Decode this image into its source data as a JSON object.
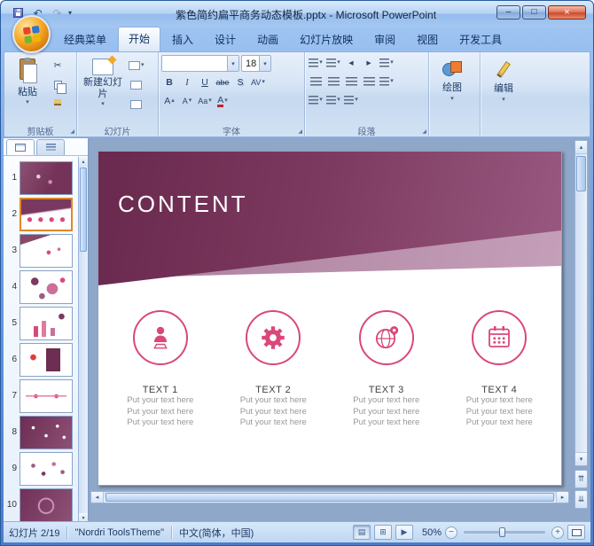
{
  "window": {
    "title": "紫色简约扁平商务动态模板.pptx - Microsoft PowerPoint",
    "minimize": "–",
    "maximize": "□",
    "close": "×"
  },
  "icons": {
    "undo": "↶",
    "redo": "↷",
    "caret": "▾",
    "caret_up": "▴",
    "cut": "✂",
    "arrow_up": "▴",
    "arrow_down": "▾",
    "arrow_left": "◂",
    "arrow_right": "▸",
    "prev_slides": "⇈",
    "next_slides": "⇊",
    "view_normal": "▤",
    "view_sorter": "⊞",
    "view_show": "▶",
    "zoom_out": "−",
    "zoom_in": "+",
    "launcher": "◢"
  },
  "ribbon": {
    "tabs": [
      "经典菜单",
      "开始",
      "插入",
      "设计",
      "动画",
      "幻灯片放映",
      "审阅",
      "视图",
      "开发工具"
    ],
    "active_tab": "开始",
    "clipboard": {
      "group_label": "剪贴板",
      "paste": "粘贴"
    },
    "slides_group": {
      "group_label": "幻灯片",
      "new_slide": "新建幻灯片"
    },
    "font": {
      "group_label": "字体",
      "font_name": "",
      "font_size": "18",
      "bold": "B",
      "italic": "I",
      "underline": "U",
      "strikethrough": "abe",
      "shadow": "S",
      "char_spacing": "AV",
      "change_case": "Aa",
      "color_letter": "A",
      "grow_letter": "A",
      "shrink_letter": "A"
    },
    "paragraph": {
      "group_label": "段落"
    },
    "drawing": {
      "label": "绘图"
    },
    "editing": {
      "label": "编辑"
    }
  },
  "panel": {
    "slides": [
      {
        "number": "1"
      },
      {
        "number": "2"
      },
      {
        "number": "3"
      },
      {
        "number": "4"
      },
      {
        "number": "5"
      },
      {
        "number": "6"
      },
      {
        "number": "7"
      },
      {
        "number": "8"
      },
      {
        "number": "9"
      },
      {
        "number": "10"
      }
    ],
    "selected_number": "2"
  },
  "slide": {
    "title": "CONTENT",
    "items": [
      {
        "heading": "TEXT 1",
        "lines": [
          "Put your text here",
          "Put your text here",
          "Put your text here"
        ]
      },
      {
        "heading": "TEXT 2",
        "lines": [
          "Put your text here",
          "Put your text here",
          "Put your text here"
        ]
      },
      {
        "heading": "TEXT 3",
        "lines": [
          "Put your text here",
          "Put your text here",
          "Put your text here"
        ]
      },
      {
        "heading": "TEXT 4",
        "lines": [
          "Put your text here",
          "Put your text here",
          "Put your text here"
        ]
      }
    ]
  },
  "statusbar": {
    "slide_indicator": "幻灯片 2/19",
    "theme": "\"Nordri ToolsTheme\"",
    "language": "中文(简体，中国)",
    "zoom": "50%"
  },
  "colors": {
    "accent_pink": "#d9487c",
    "band_dark": "#6b2a4f",
    "band_light": "#c7a2bb",
    "selection_orange": "#e0862d"
  }
}
